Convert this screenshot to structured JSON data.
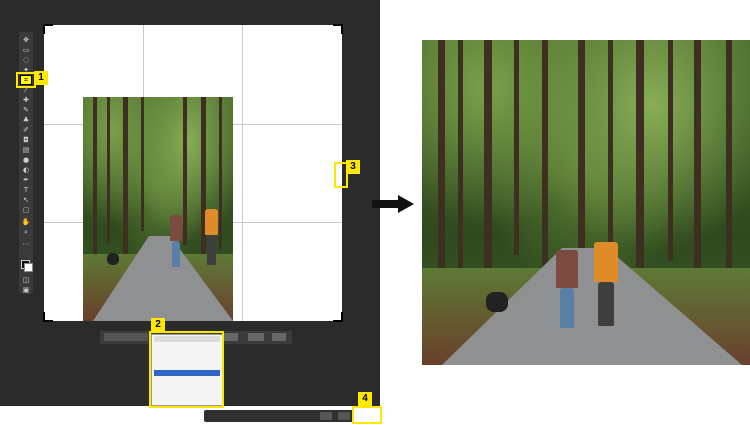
{
  "badges": {
    "one": "1",
    "two": "2",
    "three": "3",
    "four": "4"
  },
  "icons": {
    "crop": "crop-icon",
    "arrow": "arrow-right-icon"
  },
  "colors": {
    "highlight": "#ffe800",
    "editor_bg": "#2b2b2b",
    "selection": "#2e67c9"
  }
}
